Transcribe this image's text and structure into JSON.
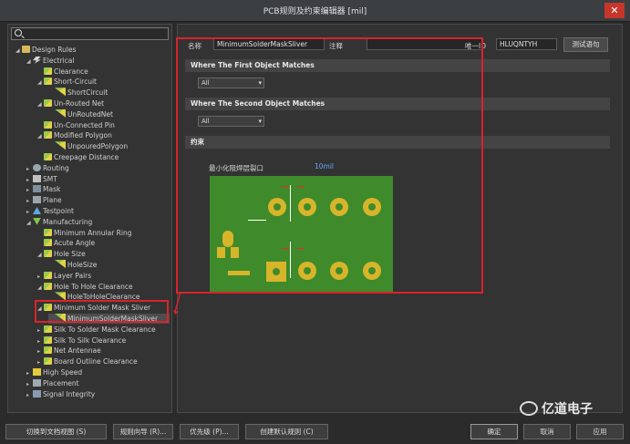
{
  "window": {
    "title": "PCB规则及约束编辑器 [mil]",
    "close": "✕"
  },
  "search": {
    "value": ""
  },
  "tree": [
    {
      "label": "Design Rules",
      "icon": "folder-icon",
      "exp": "◢"
    },
    {
      "label": "Electrical",
      "icon": "bolt-icon",
      "exp": "◢"
    },
    {
      "label": "Clearance",
      "icon": "rule-icon",
      "exp": ""
    },
    {
      "label": "Short-Circuit",
      "icon": "rule-icon",
      "exp": "◢"
    },
    {
      "label": "ShortCircuit",
      "icon": "rule-icon",
      "exp": ""
    },
    {
      "label": "Un-Routed Net",
      "icon": "rule-icon",
      "exp": "◢"
    },
    {
      "label": "UnRoutedNet",
      "icon": "rule-icon",
      "exp": ""
    },
    {
      "label": "Un-Connected Pin",
      "icon": "rule-icon",
      "exp": ""
    },
    {
      "label": "Modified Polygon",
      "icon": "rule-icon",
      "exp": "◢"
    },
    {
      "label": "UnpouredPolygon",
      "icon": "rule-icon",
      "exp": ""
    },
    {
      "label": "Creepage Distance",
      "icon": "rule-icon",
      "exp": ""
    },
    {
      "label": "Routing",
      "icon": "routing-icon",
      "exp": "▸"
    },
    {
      "label": "SMT",
      "icon": "smt-icon",
      "exp": "▸"
    },
    {
      "label": "Mask",
      "icon": "mask-icon",
      "exp": "▸"
    },
    {
      "label": "Plane",
      "icon": "plane-icon",
      "exp": "▸"
    },
    {
      "label": "Testpoint",
      "icon": "testpoint-icon",
      "exp": "▸"
    },
    {
      "label": "Manufacturing",
      "icon": "manufacturing-icon",
      "exp": "◢"
    },
    {
      "label": "Minimum Annular Ring",
      "icon": "rule-icon",
      "exp": ""
    },
    {
      "label": "Acute Angle",
      "icon": "rule-icon",
      "exp": ""
    },
    {
      "label": "Hole Size",
      "icon": "rule-icon",
      "exp": "◢"
    },
    {
      "label": "HoleSize",
      "icon": "rule-icon",
      "exp": ""
    },
    {
      "label": "Layer Pairs",
      "icon": "rule-icon",
      "exp": "▸"
    },
    {
      "label": "Hole To Hole Clearance",
      "icon": "rule-icon",
      "exp": "◢"
    },
    {
      "label": "HoleToHoleClearance",
      "icon": "rule-icon",
      "exp": ""
    },
    {
      "label": "Minimum Solder Mask Sliver",
      "icon": "rule-icon",
      "exp": "◢"
    },
    {
      "label": "MinimumSolderMaskSliver",
      "icon": "rule-icon",
      "exp": ""
    },
    {
      "label": "Silk To Solder Mask Clearance",
      "icon": "rule-icon",
      "exp": "▸"
    },
    {
      "label": "Silk To Silk Clearance",
      "icon": "rule-icon",
      "exp": "▸"
    },
    {
      "label": "Net Antennae",
      "icon": "rule-icon",
      "exp": "▸"
    },
    {
      "label": "Board Outline Clearance",
      "icon": "rule-icon",
      "exp": "▸"
    },
    {
      "label": "High Speed",
      "icon": "high-speed-icon",
      "exp": "▸"
    },
    {
      "label": "Placement",
      "icon": "placement-icon",
      "exp": "▸"
    },
    {
      "label": "Signal Integrity",
      "icon": "signal-integrity-icon",
      "exp": "▸"
    }
  ],
  "rule": {
    "name_label": "名称",
    "name_value": "MinimumSolderMaskSliver",
    "comment_label": "注释",
    "comment_value": "",
    "uid_label": "唯一ID",
    "uid_value": "HLUQNTYH",
    "test_button": "测试语句"
  },
  "first_match": {
    "header": "Where The First Object Matches",
    "selected": "All"
  },
  "second_match": {
    "header": "Where The Second Object Matches",
    "selected": "All"
  },
  "constraints": {
    "header": "约束",
    "sliver_label": "最小化阻焊层裂口",
    "sliver_value": "10mil"
  },
  "buttons": {
    "doc_view": "切换到文档视图 (S)",
    "wizard": "规则向导 (R)...",
    "priority": "优先级 (P)...",
    "default_rules": "创建默认规则 (C)",
    "ok": "确定",
    "cancel": "取消",
    "apply": "应用"
  },
  "watermark": "亿道电子",
  "colors": {
    "highlight": "#d9232b",
    "board": "#3f8a2a",
    "pad": "#d7b52a"
  }
}
